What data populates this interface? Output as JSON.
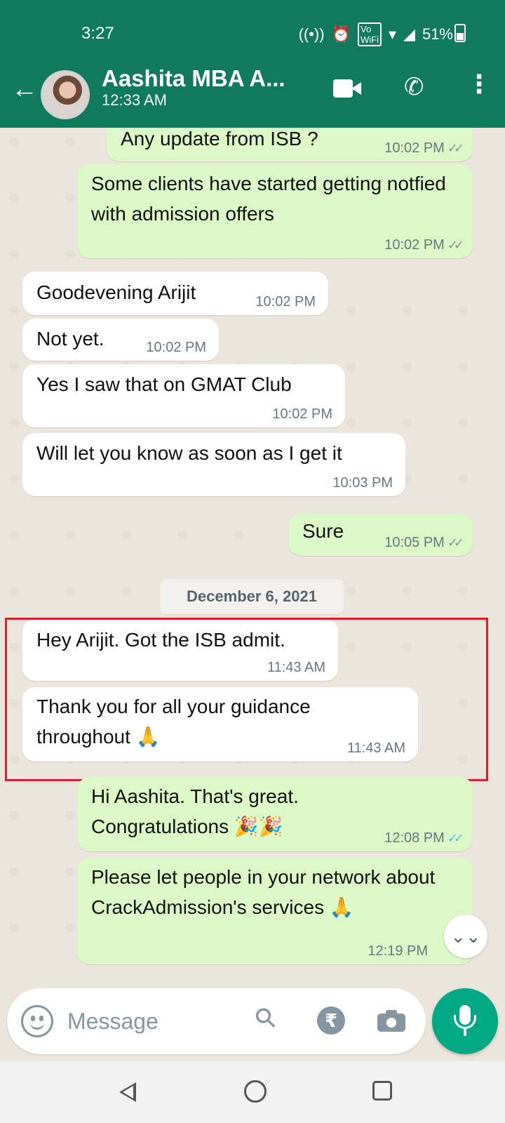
{
  "status_bar": {
    "time": "3:27",
    "icons": [
      "hotspot-icon",
      "alarm-icon",
      "vowifi-icon",
      "wifi-icon",
      "signal-icon"
    ],
    "battery": "51%"
  },
  "header": {
    "contact_name": "Aashita MBA A...",
    "last_seen": "12:33 AM"
  },
  "messages": [
    {
      "dir": "out",
      "text": "Any update from ISB ?",
      "time": "10:02 PM",
      "ticks": "✓✓",
      "read": false
    },
    {
      "dir": "out",
      "text": "Some clients have started getting notfied with admission offers",
      "time": "10:02 PM",
      "ticks": "✓✓",
      "read": false
    },
    {
      "dir": "in",
      "text": "Goodevening Arijit",
      "time": "10:02 PM"
    },
    {
      "dir": "in",
      "text": "Not yet.",
      "time": "10:02 PM"
    },
    {
      "dir": "in",
      "text": "Yes I saw that on GMAT Club",
      "time": "10:02 PM"
    },
    {
      "dir": "in",
      "text": "Will let you know as soon as I get it",
      "time": "10:03 PM"
    },
    {
      "dir": "out",
      "text": "Sure",
      "time": "10:05 PM",
      "ticks": "✓✓",
      "read": false
    },
    {
      "dir": "in",
      "text": "Hey Arijit. Got the ISB admit.",
      "time": "11:43 AM"
    },
    {
      "dir": "in",
      "text": "Thank you for all your guidance throughout 🙏",
      "time": "11:43 AM"
    },
    {
      "dir": "out",
      "text": "Hi Aashita. That's great. Congratulations 🎉🎉",
      "time": "12:08 PM",
      "ticks": "✓✓",
      "read": true
    },
    {
      "dir": "out",
      "text": "Please let people in your network about CrackAdmission's services 🙏",
      "time": "12:19 PM",
      "ticks": "",
      "read": false
    }
  ],
  "date_separator": "December 6, 2021",
  "composer": {
    "placeholder": "Message",
    "rupee_symbol": "₹"
  },
  "colors": {
    "header": "#0f7a5e",
    "outgoing_bubble": "#dcf8c6",
    "incoming_bubble": "#ffffff",
    "mic_button": "#00a884",
    "highlight_border": "#d9222a",
    "read_ticks": "#53bdeb"
  }
}
